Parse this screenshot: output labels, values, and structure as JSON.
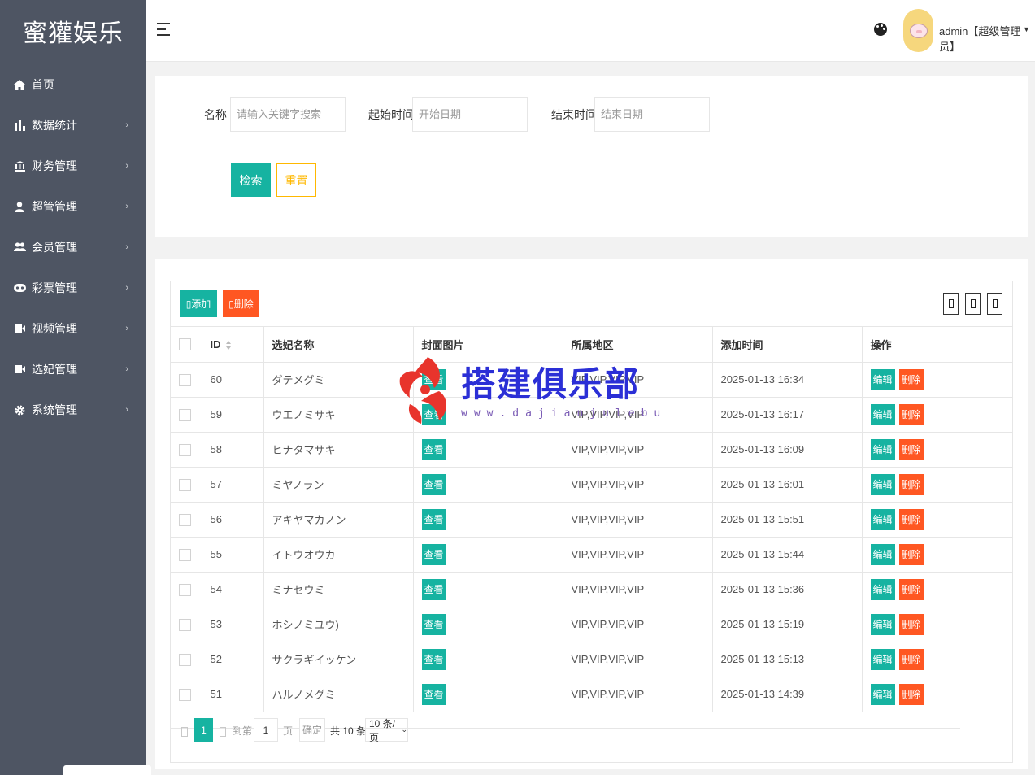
{
  "app": {
    "logo_text": "蜜獾娱乐"
  },
  "sidebar": {
    "items": [
      {
        "label": "首页",
        "icon": "home-icon",
        "has_arrow": false
      },
      {
        "label": "数据统计",
        "icon": "bar-chart-icon",
        "has_arrow": true
      },
      {
        "label": "财务管理",
        "icon": "bank-icon",
        "has_arrow": true
      },
      {
        "label": "超管管理",
        "icon": "user-icon",
        "has_arrow": true
      },
      {
        "label": "会员管理",
        "icon": "users-icon",
        "has_arrow": true
      },
      {
        "label": "彩票管理",
        "icon": "gamepad-icon",
        "has_arrow": true
      },
      {
        "label": "视频管理",
        "icon": "video-icon",
        "has_arrow": true
      },
      {
        "label": "选妃管理",
        "icon": "video-icon",
        "has_arrow": true
      },
      {
        "label": "系统管理",
        "icon": "gear-icon",
        "has_arrow": true
      }
    ]
  },
  "header": {
    "user_name": "admin【超级管理员】"
  },
  "search": {
    "name_label": "名称",
    "name_placeholder": "请输入关键字搜索",
    "start_label": "起始时间",
    "start_placeholder": "开始日期",
    "end_label": "结束时间",
    "end_placeholder": "结束日期",
    "search_button": "检索",
    "reset_button": "重置"
  },
  "toolbar": {
    "add_label": "添加",
    "delete_label": "删除"
  },
  "table": {
    "columns": [
      "ID",
      "选妃名称",
      "封面图片",
      "所属地区",
      "添加时间",
      "操作"
    ],
    "view_label": "查看",
    "edit_label": "编辑",
    "remove_label": "删除",
    "rows": [
      {
        "id": "60",
        "name": "ダテメグミ",
        "region": "VIP,VIP,VIP,VIP",
        "time": "2025-01-13 16:34"
      },
      {
        "id": "59",
        "name": "ウエノミサキ",
        "region": "VIP,VIP,VIP,VIP",
        "time": "2025-01-13 16:17"
      },
      {
        "id": "58",
        "name": "ヒナタマサキ",
        "region": "VIP,VIP,VIP,VIP",
        "time": "2025-01-13 16:09"
      },
      {
        "id": "57",
        "name": "ミヤノラン",
        "region": "VIP,VIP,VIP,VIP",
        "time": "2025-01-13 16:01"
      },
      {
        "id": "56",
        "name": "アキヤマカノン",
        "region": "VIP,VIP,VIP,VIP",
        "time": "2025-01-13 15:51"
      },
      {
        "id": "55",
        "name": "イトウオウカ",
        "region": "VIP,VIP,VIP,VIP",
        "time": "2025-01-13 15:44"
      },
      {
        "id": "54",
        "name": "ミナセウミ",
        "region": "VIP,VIP,VIP,VIP",
        "time": "2025-01-13 15:36"
      },
      {
        "id": "53",
        "name": "ホシノミユウ)",
        "region": "VIP,VIP,VIP,VIP",
        "time": "2025-01-13 15:19"
      },
      {
        "id": "52",
        "name": "サクラギイッケン",
        "region": "VIP,VIP,VIP,VIP",
        "time": "2025-01-13 15:13"
      },
      {
        "id": "51",
        "name": "ハルノメグミ",
        "region": "VIP,VIP,VIP,VIP",
        "time": "2025-01-13 14:39"
      }
    ]
  },
  "pagination": {
    "current_page": "1",
    "goto_label": "到第",
    "goto_value": "1",
    "page_label": "页",
    "confirm_label": "确定",
    "total_label": "共 10 条",
    "page_size": "10 条/页"
  },
  "watermark": {
    "title": "搭建俱乐部",
    "url": "www.dajianjulebu"
  },
  "colors": {
    "sidebar_bg": "#4e5563",
    "primary": "#16b3a1",
    "danger": "#ff5722",
    "warning": "#ffb800"
  }
}
